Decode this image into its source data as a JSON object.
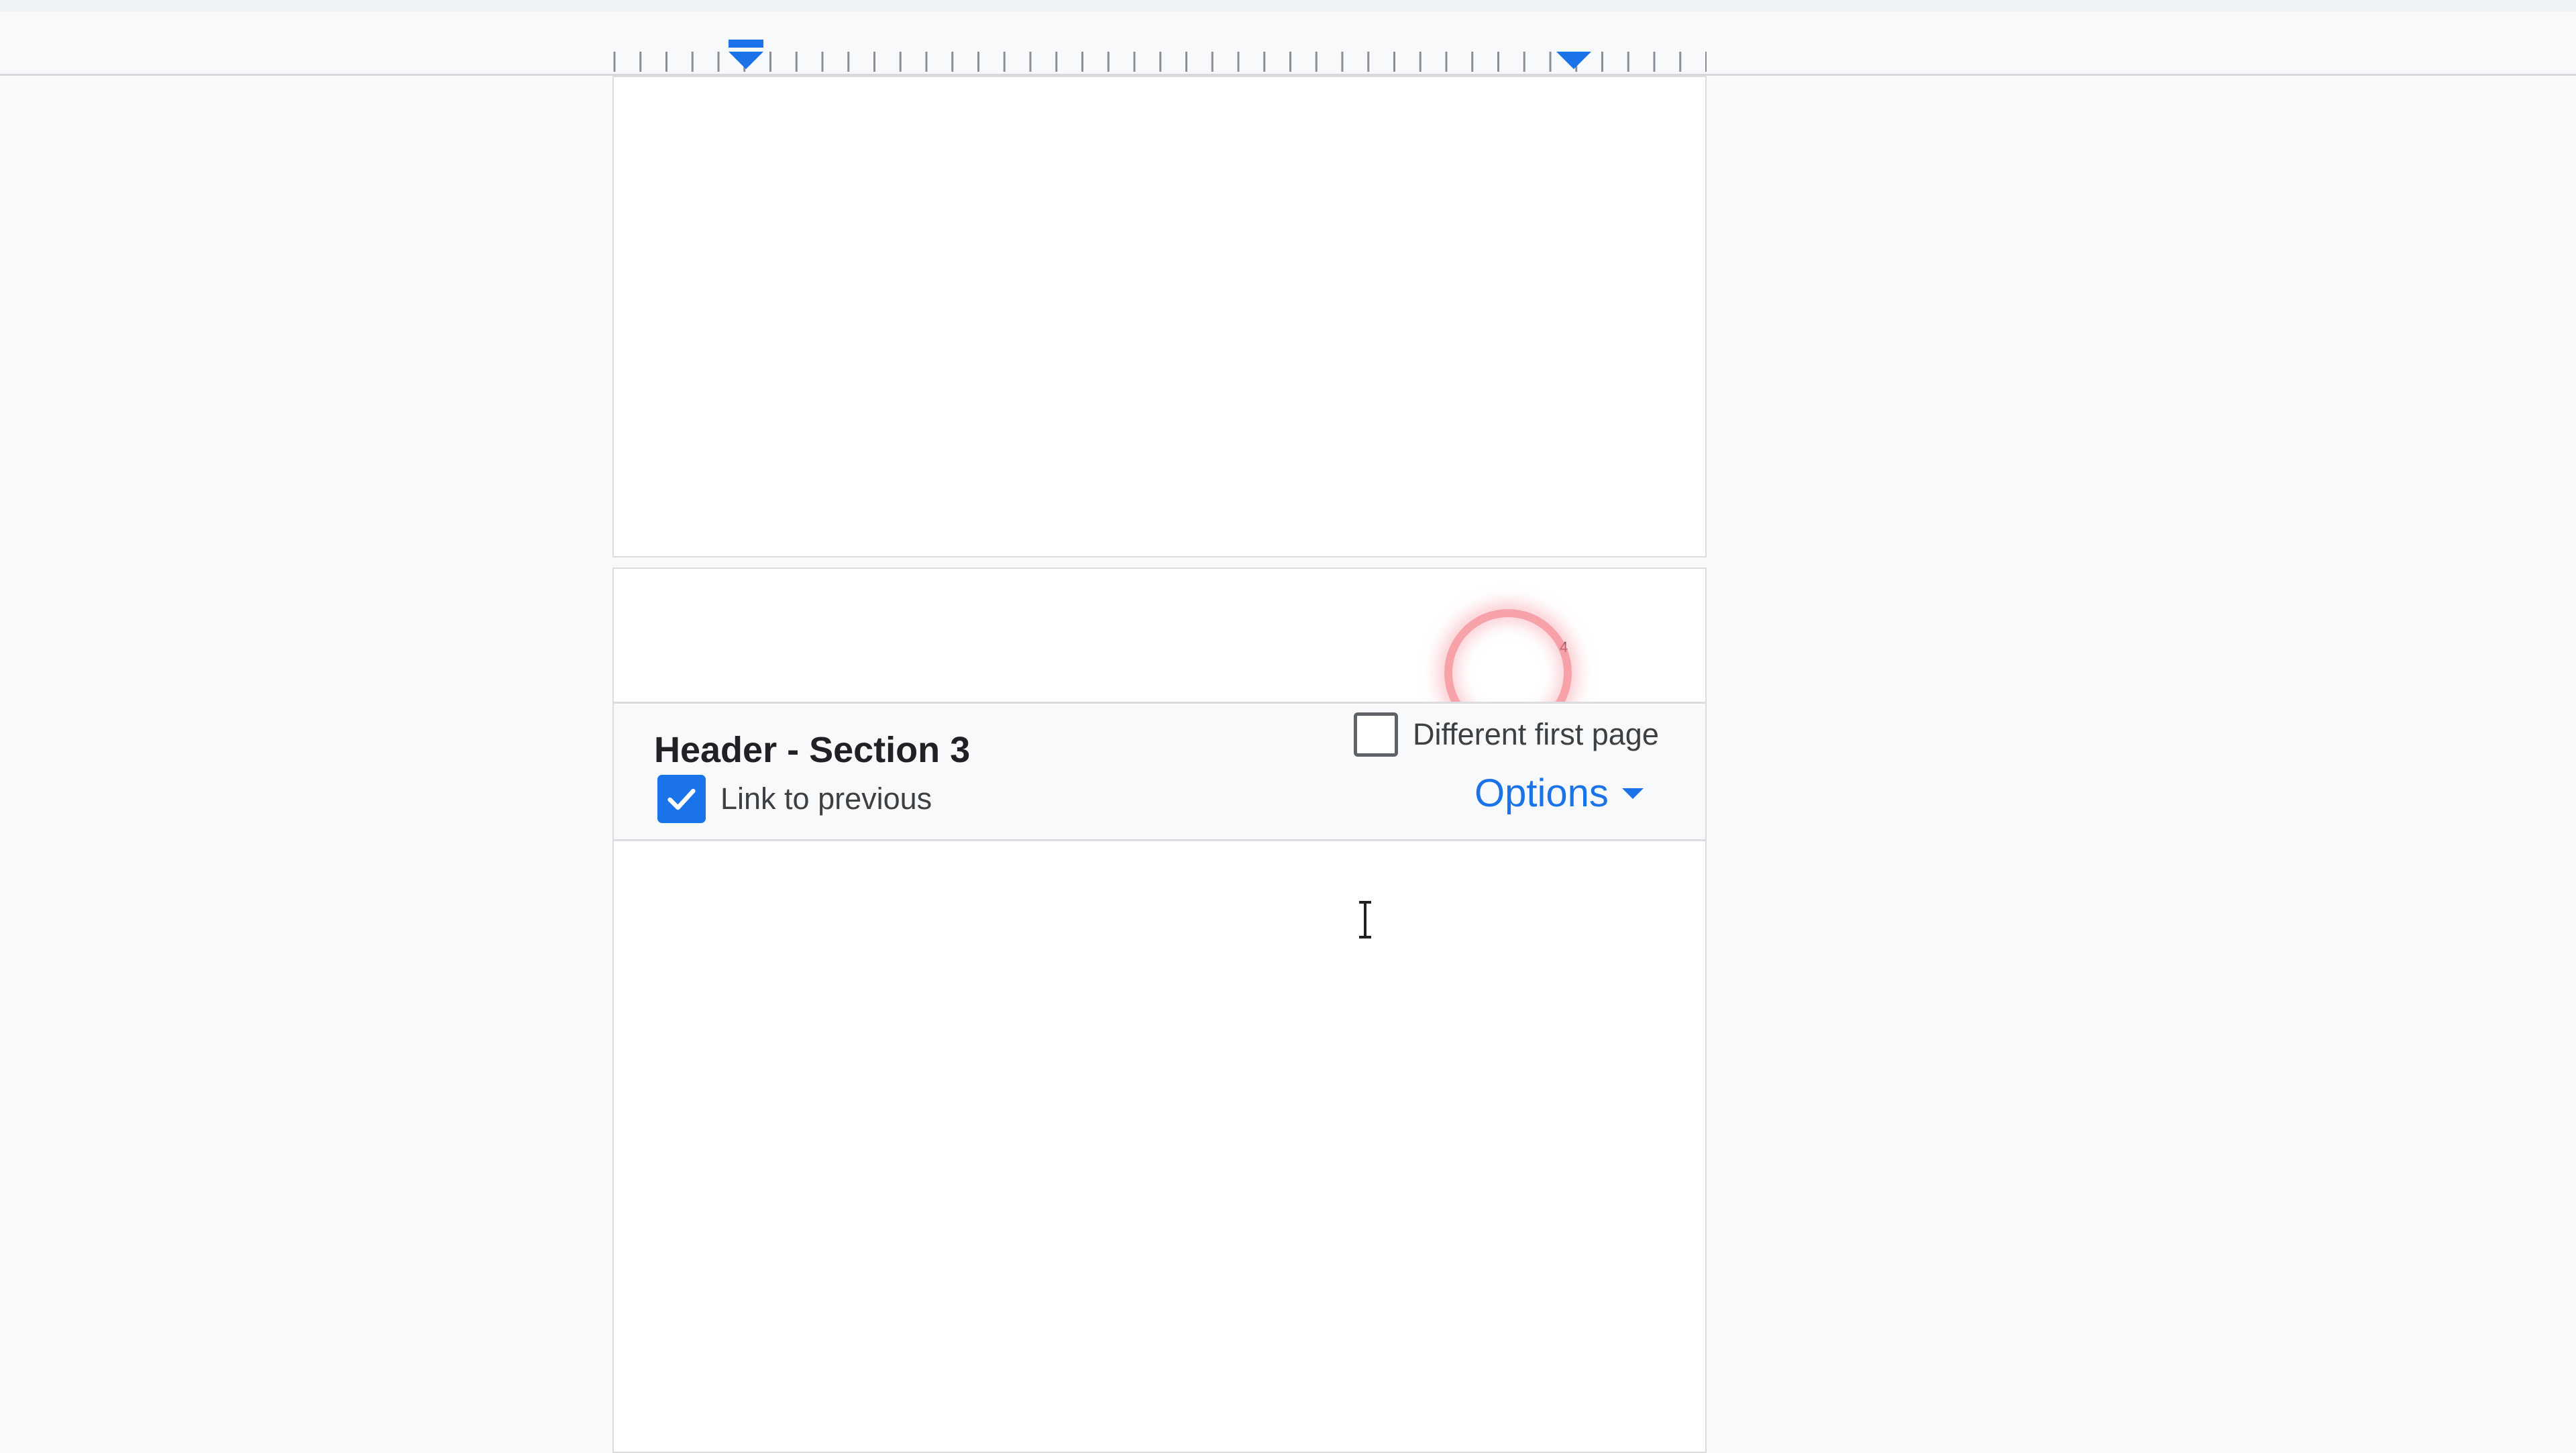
{
  "header_footer_bar": {
    "title": "Header - Section 3",
    "link_to_previous": {
      "label": "Link to previous",
      "checked": true
    },
    "different_first_page": {
      "label": "Different first page",
      "checked": false
    },
    "options_label": "Options",
    "options_icon": "arrow-drop-down-icon"
  },
  "header": {
    "page_number": "4"
  },
  "colors": {
    "accent": "#1a73e8",
    "click_highlight": "#f4828c",
    "background": "#f8f9fa"
  },
  "icons": {
    "checkbox_checked": "check-icon",
    "ruler_indent": "indent-marker-icon",
    "cursor": "text-cursor-icon"
  }
}
